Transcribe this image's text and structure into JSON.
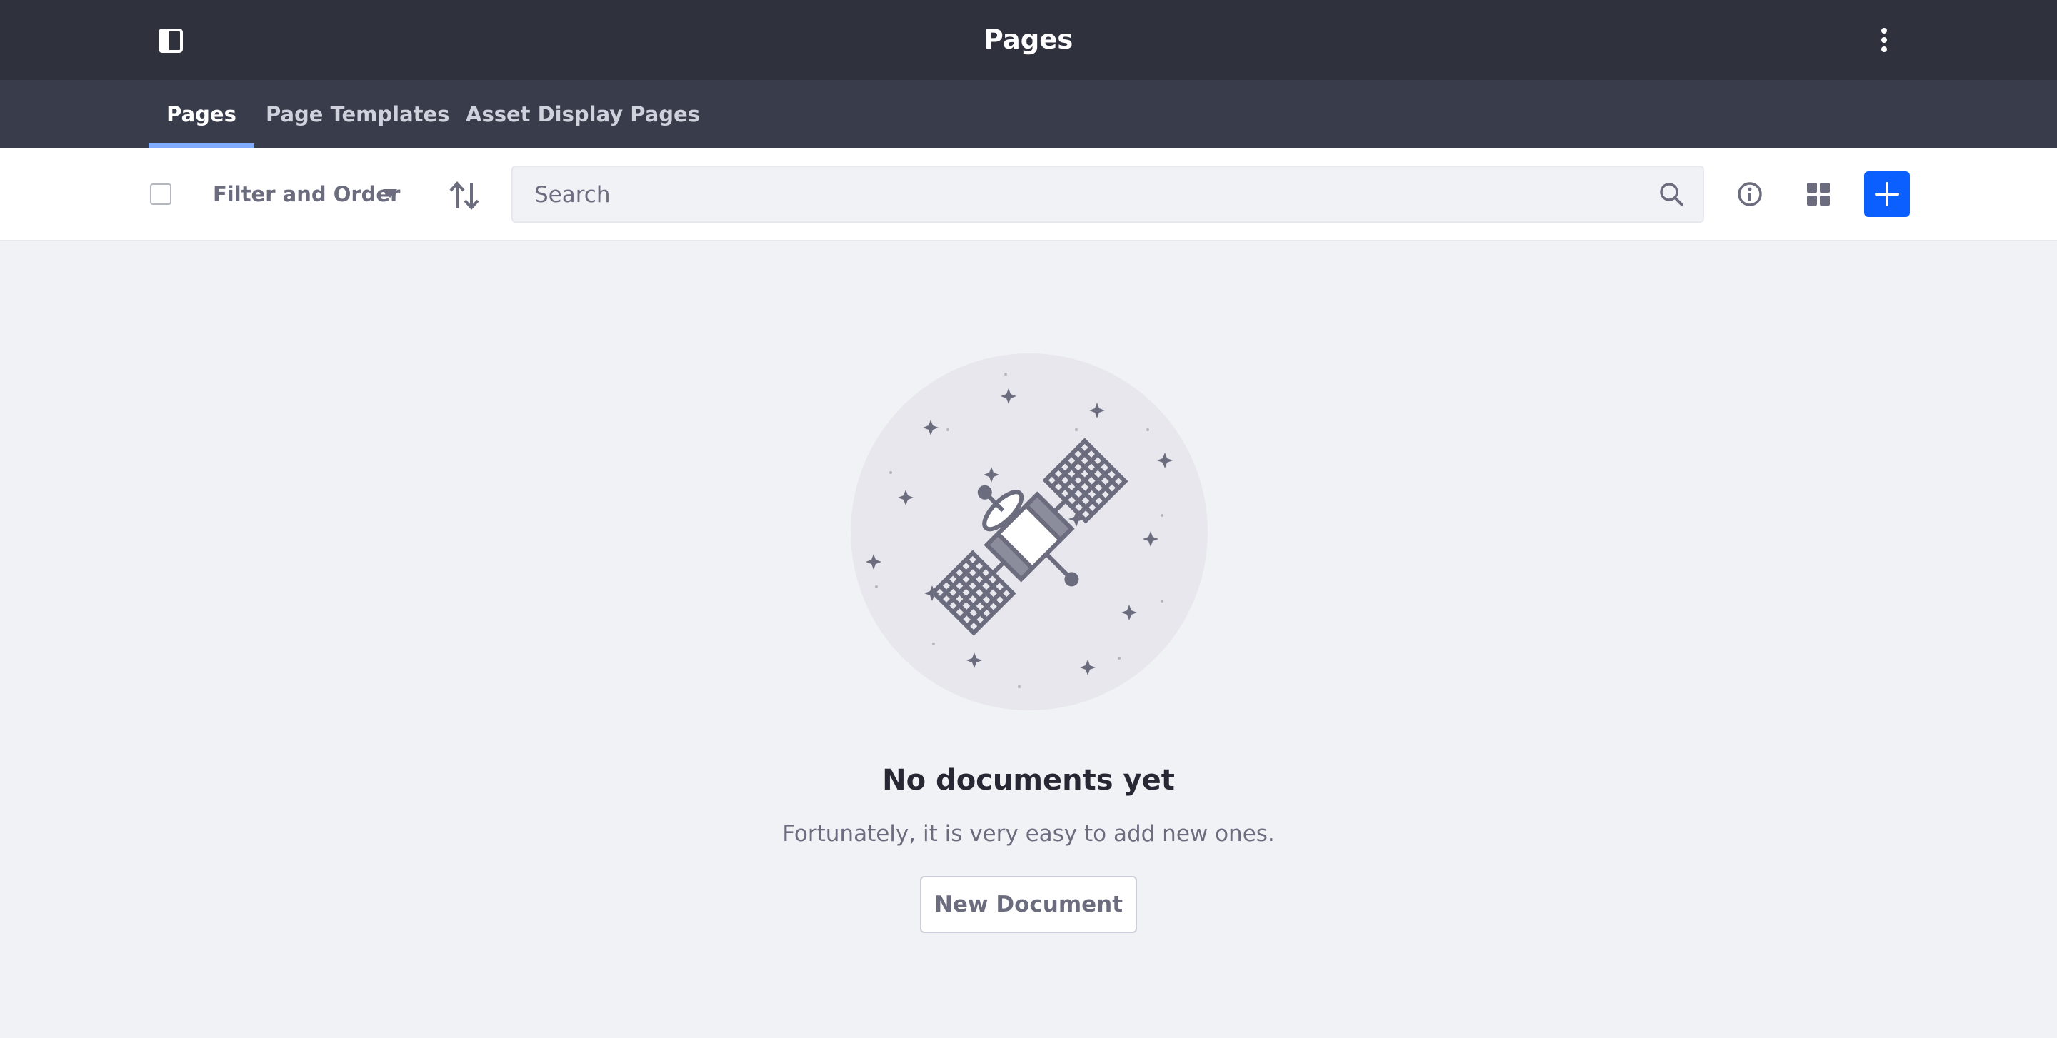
{
  "header": {
    "title": "Pages",
    "left_icon": "sidebar-toggle-icon",
    "right_icon": "ellipsis-vertical-icon"
  },
  "tabs": [
    {
      "label": "Pages",
      "active": true
    },
    {
      "label": "Page Templates",
      "active": false
    },
    {
      "label": "Asset Display Pages",
      "active": false
    }
  ],
  "toolbar": {
    "select_all_checked": false,
    "filter_label": "Filter and Order",
    "sort_icon": "order-arrows-icon",
    "search_placeholder": "Search",
    "search_value": "",
    "info_icon": "info-circle-icon",
    "view_icon": "cards-grid-icon",
    "add_icon": "plus-icon"
  },
  "empty_state": {
    "title": "No documents yet",
    "description": "Fortunately, it is very easy to add new ones.",
    "button_label": "New Document",
    "illustration": "satellite-illustration"
  },
  "colors": {
    "header_bg": "#2f323d",
    "tabbar_bg": "#393c4a",
    "tab_active_indicator": "#80acff",
    "primary": "#0b5fff",
    "page_bg": "#f1f2f5"
  }
}
